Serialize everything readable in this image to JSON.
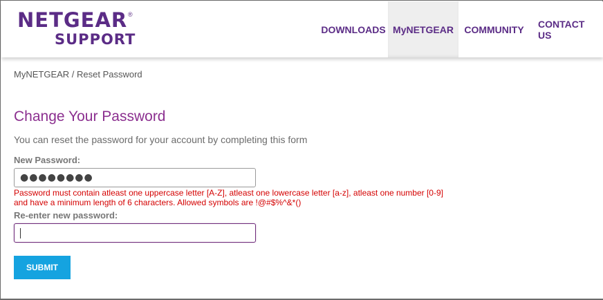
{
  "logo": {
    "top": "NETGEAR",
    "reg": "®",
    "bottom": "SUPPORT"
  },
  "nav": {
    "downloads": "DOWNLOADS",
    "mynetgear": "MyNETGEAR",
    "community": "COMMUNITY",
    "contact": "CONTACT US",
    "active": "MyNETGEAR"
  },
  "breadcrumb": {
    "parent": "MyNETGEAR",
    "separator": " / ",
    "current": "Reset Password"
  },
  "form": {
    "title": "Change Your Password",
    "subtitle": "You can reset the password for your account by completing this form",
    "new_password_label": "New Password:",
    "new_password_value": "●●●●●●●●",
    "error_line1": "Password must contain atleast one uppercase letter [A-Z], atleast one lowercase letter [a-z], atleast one number [0-9]",
    "error_line2": "and have a minimum length of 6 characters. Allowed symbols are !@#$%^&*()",
    "reenter_label": "Re-enter new password:",
    "reenter_value": "",
    "submit_label": "SUBMIT"
  },
  "colors": {
    "brand_purple": "#5b2c86",
    "title_purple": "#8b2f8f",
    "error_red": "#d40000",
    "submit_blue": "#15a3e0"
  }
}
